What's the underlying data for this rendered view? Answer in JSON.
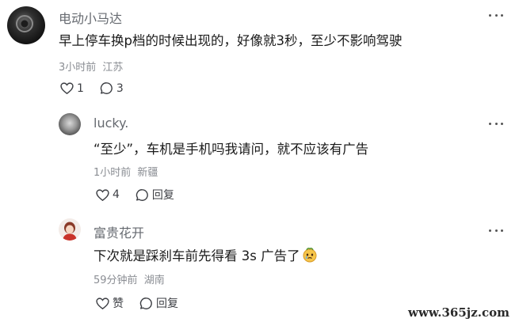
{
  "comments": [
    {
      "username": "电动小马达",
      "text": "早上停车换p档的时候出现的，好像就3秒，至少不影响驾驶",
      "time": "3小时前",
      "location": "江苏",
      "likes": "1",
      "replies": "3"
    },
    {
      "username": "lucky.",
      "text": "“至少”，车机是手机吗我请问，就不应该有广告",
      "time": "1小时前",
      "location": "新疆",
      "likes": "4",
      "reply_label": "回复"
    },
    {
      "username": "富贵花开",
      "text": "下次就是踩刹车前先得看 3s 广告了",
      "emoji": "crying-face-emoji",
      "time": "59分钟前",
      "location": "湖南",
      "like_label": "赞",
      "reply_label": "回复"
    }
  ],
  "watermark": "www.365jz.com"
}
